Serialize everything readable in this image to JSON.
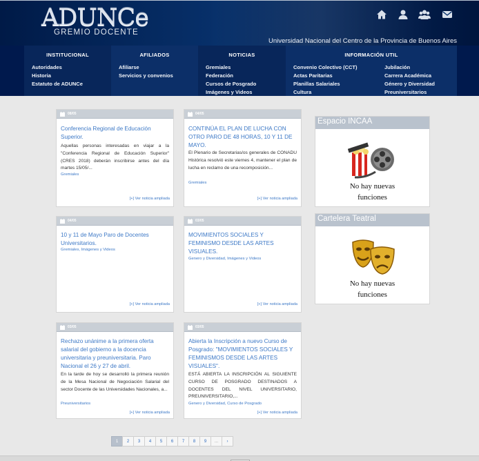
{
  "header": {
    "logo_text": "ADUNCe",
    "logo_subtitle": "GREMIO DOCENTE",
    "university": "Universidad Nacional del Centro de la Provincia de Buenos Aires",
    "icons": [
      "home-icon",
      "user-icon",
      "users-icon",
      "envelope-icon"
    ]
  },
  "nav": {
    "institucional": {
      "head": "INSTITUCIONAL",
      "items": [
        "Autoridades",
        "Historia",
        "Estatuto de ADUNCe"
      ]
    },
    "afiliados": {
      "head": "AFILIADOS",
      "items": [
        "Afiliarse",
        "Servicios y convenios"
      ]
    },
    "noticias": {
      "head": "NOTICIAS",
      "items": [
        "Gremiales",
        "Federación",
        "Cursos de Posgrado",
        "Imágenes y Videos"
      ]
    },
    "info": {
      "head": "INFORMACIÓN UTIL",
      "col1": [
        "Convenio Colectivo (CCT)",
        "Actas Paritarias",
        "Planillas Salariales",
        "Cultura"
      ],
      "col2": [
        "Jubilación",
        "Carrera Académica",
        "Género y Diversidad",
        "Preuniversitarios"
      ]
    }
  },
  "cards": [
    {
      "date": "08/05",
      "title": "Conferencia Regional de Educación Superior.",
      "body": "Aquellas personas interesadas en viajar a la \"Conferencia Regional de Educación Superior\" (CRES 2018) deberán inscribirse antes del día martes 15/05/...",
      "tags": [
        "Gremiales"
      ],
      "more": "[+] Ver noticia ampliada"
    },
    {
      "date": "04/05",
      "title": "CONTINÚA EL PLAN DE LUCHA CON OTRO PARO DE 48 HORAS, 10 Y 11 DE MAYO.",
      "body": "El Plenario de Secretarias/os generales de CONADU Histórica resolvió este viernes 4, mantener el plan de lucha en reclamo de una recomposición...",
      "tags": [
        "Gremiales"
      ],
      "more": "[+] Ver noticia ampliada"
    },
    {
      "date": "04/05",
      "title": "10 y 11 de Mayo Paro de Docentes Universitarios.",
      "body": "",
      "tags": [
        "Gremiales",
        "Imágenes y Videos"
      ],
      "more": "[+] Ver noticia ampliada"
    },
    {
      "date": "03/05",
      "title": "MOVIMIENTOS SOCIALES Y FEMINISMO DESDE LAS ARTES VISUALES.",
      "body": "",
      "tags": [
        "Genero y Diversidad",
        "Imágenes y Videos"
      ],
      "more": "[+] Ver noticia ampliada"
    },
    {
      "date": "03/05",
      "title": "Rechazo unánime a la primera oferta salarial del gobierno a la docencia universitaria y preuniversitaria. Paro Nacional el 26 y 27 de abril.",
      "body": "En la tarde de hoy se desarrolló la primera reunión de la Mesa Nacional de Negociación Salarial del sector Docente de las Universidades Nacionales, a...",
      "tags": [
        "Preuniversitarios"
      ],
      "more": "[+] Ver noticia ampliada"
    },
    {
      "date": "03/05",
      "title": "Abierta la Inscripción a nuevo Curso de Posgrado: \"MOVIMIENTOS SOCIALES Y FEMINISMOS DESDE LAS ARTES VISUALES\".",
      "body": "ESTÁ ABIERTA LA INSCRIPCIÓN AL SIGUIENTE CURSO DE POSGRADO DESTINADOS A DOCENTES DEL NIVEL UNIVERSITARIO, PREUNIVERSITARIO,...",
      "tags": [
        "Genero y Diversidad",
        "Curso de Posgrado"
      ],
      "more": "[+] Ver noticia ampliada"
    }
  ],
  "sidebar": [
    {
      "title": "Espacio INCAA",
      "text1": "No hay nuevas",
      "text2": "funciones",
      "image": "film-reel-popcorn-icon"
    },
    {
      "title": "Cartelera Teatral",
      "text1": "No hay nuevas",
      "text2": "funciones",
      "image": "theater-masks-icon"
    }
  ],
  "pager": {
    "pages": [
      "1",
      "2",
      "3",
      "4",
      "5",
      "6",
      "7",
      "8",
      "9",
      "...",
      "›"
    ],
    "active": "1"
  },
  "colors": {
    "header": "#07306a",
    "nav": "#00194d",
    "link": "#3c78c6",
    "date_bar": "#c9cfd6"
  }
}
